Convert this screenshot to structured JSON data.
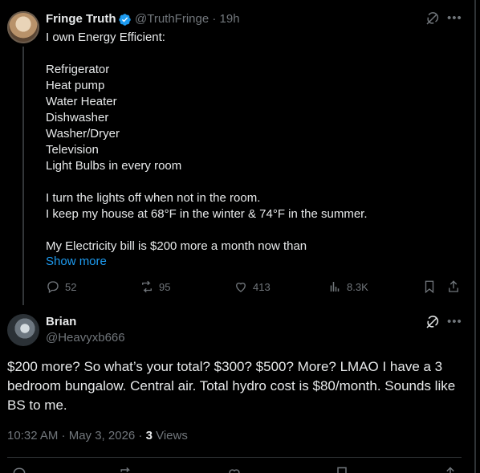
{
  "tweet1": {
    "name": "Fringe Truth",
    "handle": "@TruthFringe",
    "separator": "·",
    "time": "19h",
    "lines": [
      "I own Energy Efficient:",
      "",
      "Refrigerator",
      "Heat pump",
      "Water Heater",
      "Dishwasher",
      "Washer/Dryer",
      "Television",
      "Light Bulbs in every room",
      "",
      "I turn the lights off when not in the room.",
      "I keep my house at 68°F in the winter & 74°F in the summer.",
      "",
      "My Electricity bill is $200 more a month now than"
    ],
    "show_more": "Show more",
    "replies": "52",
    "reposts": "95",
    "likes": "413",
    "views": "8.3K"
  },
  "tweet2": {
    "name": "Brian",
    "handle": "@Heavyxb666",
    "text": "$200 more? So what’s your total? $300? $500? More? LMAO I have a 3 bedroom bungalow. Central air. Total hydro cost is $80/month. Sounds like BS to me.",
    "timestamp": "10:32 AM · May 3, 2026",
    "meta_sep": " · ",
    "views_count": "3",
    "views_label": " Views"
  },
  "icons": {
    "verified": "verified-badge-icon",
    "grok": "grok-icon",
    "more": "more-icon",
    "reply": "reply-icon",
    "repost": "repost-icon",
    "like": "like-icon",
    "views": "views-icon",
    "bookmark": "bookmark-icon",
    "share": "share-icon"
  },
  "colors": {
    "background": "#000000",
    "text": "#e7e9ea",
    "muted": "#71767b",
    "accent": "#1d9bf0"
  }
}
